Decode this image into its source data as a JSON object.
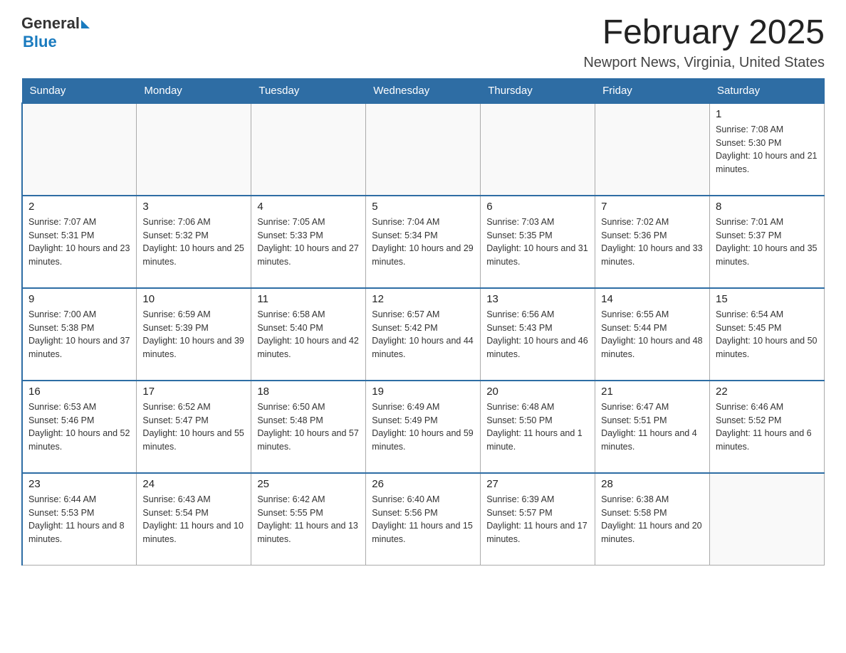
{
  "header": {
    "logo_general": "General",
    "logo_blue": "Blue",
    "month_title": "February 2025",
    "location": "Newport News, Virginia, United States"
  },
  "days_of_week": [
    "Sunday",
    "Monday",
    "Tuesday",
    "Wednesday",
    "Thursday",
    "Friday",
    "Saturday"
  ],
  "weeks": [
    [
      {
        "day": "",
        "info": ""
      },
      {
        "day": "",
        "info": ""
      },
      {
        "day": "",
        "info": ""
      },
      {
        "day": "",
        "info": ""
      },
      {
        "day": "",
        "info": ""
      },
      {
        "day": "",
        "info": ""
      },
      {
        "day": "1",
        "info": "Sunrise: 7:08 AM\nSunset: 5:30 PM\nDaylight: 10 hours and 21 minutes."
      }
    ],
    [
      {
        "day": "2",
        "info": "Sunrise: 7:07 AM\nSunset: 5:31 PM\nDaylight: 10 hours and 23 minutes."
      },
      {
        "day": "3",
        "info": "Sunrise: 7:06 AM\nSunset: 5:32 PM\nDaylight: 10 hours and 25 minutes."
      },
      {
        "day": "4",
        "info": "Sunrise: 7:05 AM\nSunset: 5:33 PM\nDaylight: 10 hours and 27 minutes."
      },
      {
        "day": "5",
        "info": "Sunrise: 7:04 AM\nSunset: 5:34 PM\nDaylight: 10 hours and 29 minutes."
      },
      {
        "day": "6",
        "info": "Sunrise: 7:03 AM\nSunset: 5:35 PM\nDaylight: 10 hours and 31 minutes."
      },
      {
        "day": "7",
        "info": "Sunrise: 7:02 AM\nSunset: 5:36 PM\nDaylight: 10 hours and 33 minutes."
      },
      {
        "day": "8",
        "info": "Sunrise: 7:01 AM\nSunset: 5:37 PM\nDaylight: 10 hours and 35 minutes."
      }
    ],
    [
      {
        "day": "9",
        "info": "Sunrise: 7:00 AM\nSunset: 5:38 PM\nDaylight: 10 hours and 37 minutes."
      },
      {
        "day": "10",
        "info": "Sunrise: 6:59 AM\nSunset: 5:39 PM\nDaylight: 10 hours and 39 minutes."
      },
      {
        "day": "11",
        "info": "Sunrise: 6:58 AM\nSunset: 5:40 PM\nDaylight: 10 hours and 42 minutes."
      },
      {
        "day": "12",
        "info": "Sunrise: 6:57 AM\nSunset: 5:42 PM\nDaylight: 10 hours and 44 minutes."
      },
      {
        "day": "13",
        "info": "Sunrise: 6:56 AM\nSunset: 5:43 PM\nDaylight: 10 hours and 46 minutes."
      },
      {
        "day": "14",
        "info": "Sunrise: 6:55 AM\nSunset: 5:44 PM\nDaylight: 10 hours and 48 minutes."
      },
      {
        "day": "15",
        "info": "Sunrise: 6:54 AM\nSunset: 5:45 PM\nDaylight: 10 hours and 50 minutes."
      }
    ],
    [
      {
        "day": "16",
        "info": "Sunrise: 6:53 AM\nSunset: 5:46 PM\nDaylight: 10 hours and 52 minutes."
      },
      {
        "day": "17",
        "info": "Sunrise: 6:52 AM\nSunset: 5:47 PM\nDaylight: 10 hours and 55 minutes."
      },
      {
        "day": "18",
        "info": "Sunrise: 6:50 AM\nSunset: 5:48 PM\nDaylight: 10 hours and 57 minutes."
      },
      {
        "day": "19",
        "info": "Sunrise: 6:49 AM\nSunset: 5:49 PM\nDaylight: 10 hours and 59 minutes."
      },
      {
        "day": "20",
        "info": "Sunrise: 6:48 AM\nSunset: 5:50 PM\nDaylight: 11 hours and 1 minute."
      },
      {
        "day": "21",
        "info": "Sunrise: 6:47 AM\nSunset: 5:51 PM\nDaylight: 11 hours and 4 minutes."
      },
      {
        "day": "22",
        "info": "Sunrise: 6:46 AM\nSunset: 5:52 PM\nDaylight: 11 hours and 6 minutes."
      }
    ],
    [
      {
        "day": "23",
        "info": "Sunrise: 6:44 AM\nSunset: 5:53 PM\nDaylight: 11 hours and 8 minutes."
      },
      {
        "day": "24",
        "info": "Sunrise: 6:43 AM\nSunset: 5:54 PM\nDaylight: 11 hours and 10 minutes."
      },
      {
        "day": "25",
        "info": "Sunrise: 6:42 AM\nSunset: 5:55 PM\nDaylight: 11 hours and 13 minutes."
      },
      {
        "day": "26",
        "info": "Sunrise: 6:40 AM\nSunset: 5:56 PM\nDaylight: 11 hours and 15 minutes."
      },
      {
        "day": "27",
        "info": "Sunrise: 6:39 AM\nSunset: 5:57 PM\nDaylight: 11 hours and 17 minutes."
      },
      {
        "day": "28",
        "info": "Sunrise: 6:38 AM\nSunset: 5:58 PM\nDaylight: 11 hours and 20 minutes."
      },
      {
        "day": "",
        "info": ""
      }
    ]
  ]
}
